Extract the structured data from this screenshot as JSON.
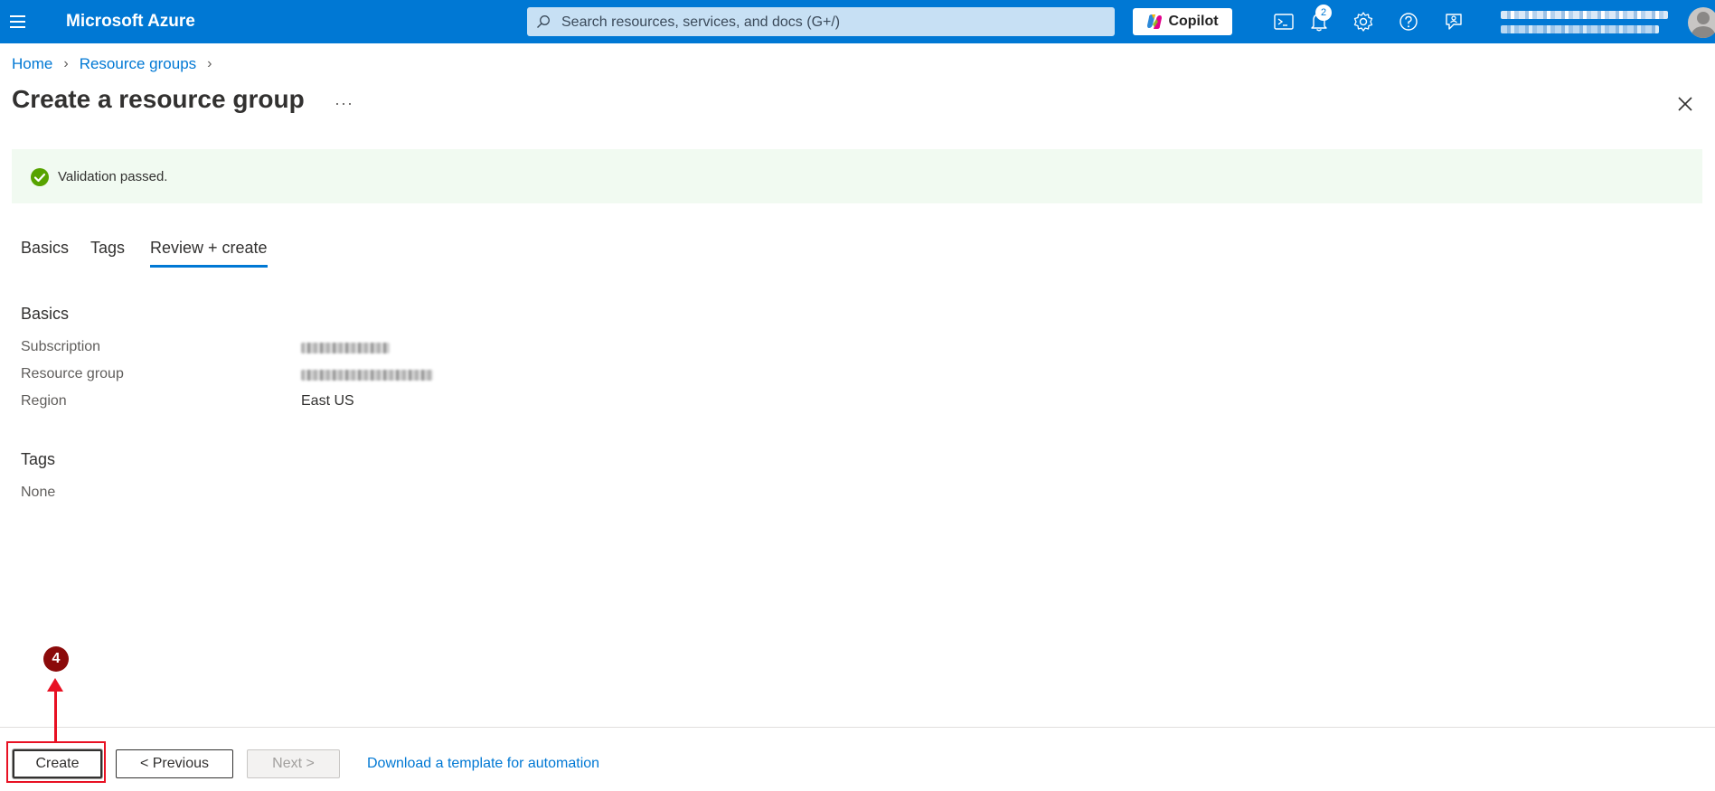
{
  "topbar": {
    "brand": "Microsoft Azure",
    "search_placeholder": "Search resources, services, and docs (G+/)",
    "copilot_label": "Copilot",
    "notification_count": "2",
    "icons": [
      "menu-icon",
      "search-icon",
      "copilot-icon",
      "cloud-shell-icon",
      "bell-icon",
      "gear-icon",
      "help-icon",
      "feedback-icon",
      "avatar"
    ],
    "color": "#0078d4"
  },
  "breadcrumb": {
    "items": [
      "Home",
      "Resource groups"
    ]
  },
  "page": {
    "title": "Create a resource group",
    "more_label": "···"
  },
  "validation": {
    "message": "Validation passed.",
    "status_color": "#57a300"
  },
  "tabs": [
    {
      "label": "Basics",
      "active": false
    },
    {
      "label": "Tags",
      "active": false
    },
    {
      "label": "Review + create",
      "active": true
    }
  ],
  "review": {
    "basics_heading": "Basics",
    "rows": [
      {
        "label": "Subscription",
        "value": ""
      },
      {
        "label": "Resource group",
        "value": ""
      },
      {
        "label": "Region",
        "value": "East US"
      }
    ],
    "tags_heading": "Tags",
    "tags_value": "None"
  },
  "footer": {
    "create_label": "Create",
    "previous_label": "< Previous",
    "next_label": "Next >",
    "next_disabled": true,
    "download_link": "Download a template for automation"
  },
  "annotation": {
    "step_number": "4",
    "color": "#e81123"
  }
}
